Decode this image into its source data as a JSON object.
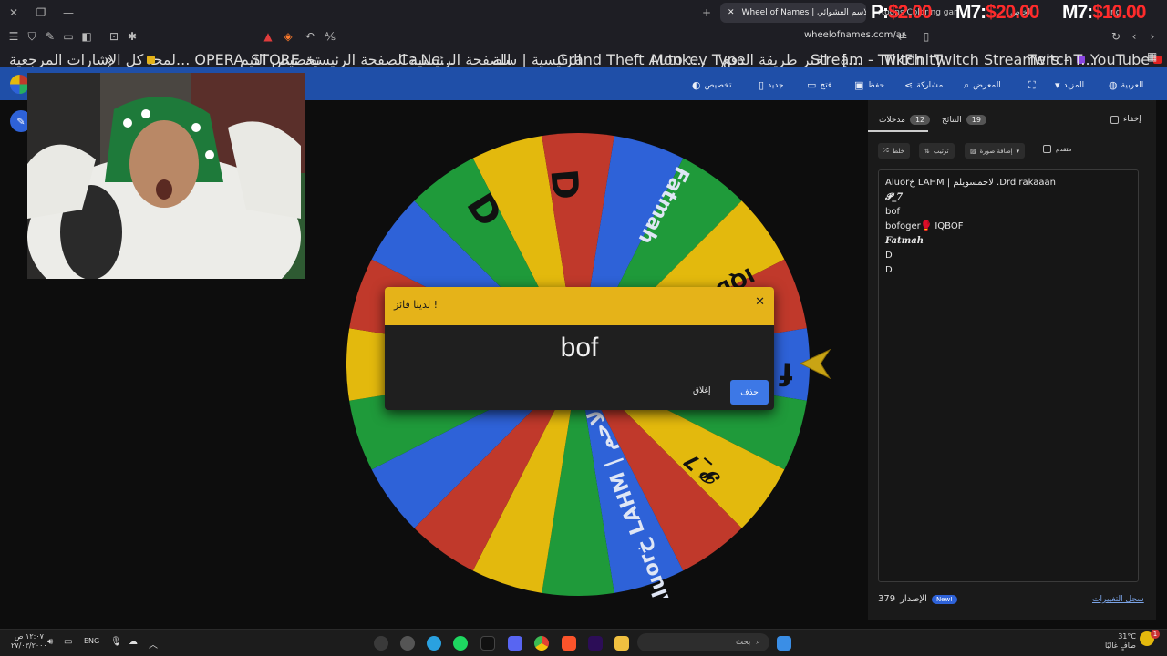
{
  "browser": {
    "active_tab": "Wheel of Names | الاسم العشوائي",
    "tab_partial_1": "rtoons Coloring games",
    "tab_partial_2": "الخاص",
    "tab_partial_3": "ng",
    "url": "wheelofnames.com/ar",
    "bookmarks": [
      "YouTube",
      "Twitch",
      "Twitch Streamers - T...",
      "TikFinity",
      "Stream - Twitch",
      "Monkey Type",
      "اختر طريقة الدفع - [...",
      "Grand Theft Auto :...",
      "الرئيسية | سلة",
      "الصفحة الرئيسية",
      "Ca...",
      "الصفحة الرئيسية - Ne...",
      "تخصيص الثيم",
      "لمحة... OPERA_STORE",
      "كل الإشارات المرجعية"
    ]
  },
  "overlay": {
    "p_label": "P:",
    "p_value": "$2.00",
    "m7a_label": "M7:",
    "m7a_value": "$20.00",
    "m7b_label": "M7:",
    "m7b_value": "$10.00"
  },
  "nav": {
    "language": "العربية",
    "more": "المزيد",
    "gallery": "المعرض",
    "share": "مشاركة",
    "save": "حفظ",
    "open": "فتح",
    "new": "جديد",
    "customize": "تخصيص"
  },
  "panel": {
    "hide_label": "إخفاء",
    "entries_tab": "مدخلات",
    "entries_count": "12",
    "results_tab": "النتائج",
    "results_count": "19",
    "shuffle": "خلط",
    "sort": "ترتيب",
    "add_image": "إضافة صورة",
    "advanced": "متقدم",
    "entries": [
      "Aluorخ LAHM | لاحمسويلم .Drd rakaaan",
      "𝓟_7",
      "bof",
      "bofoger🥊 IQBOF",
      "Fatmah",
      "D",
      "D"
    ],
    "version_label": "الإصدار",
    "version": "379",
    "new_badge": "New!",
    "changelog": "سجل التغييرات"
  },
  "dialog": {
    "title": "لدينا فائز !",
    "winner": "bof",
    "close": "إغلاق",
    "remove": "حذف"
  },
  "wheel_labels": [
    "D",
    "D",
    "Fatmah",
    "IQBO...",
    "f",
    "𝓟_7",
    "Aluorخ LAHM | لاحم..."
  ],
  "colors": {
    "red": "#c0392b",
    "blue": "#2e62d8",
    "green": "#1f9a3a",
    "yellow": "#e3b90d",
    "nav": "#1f4fa8"
  },
  "taskbar": {
    "search": "بحث",
    "language": "ENG",
    "time": "١٢:٠٧ ص",
    "date": "٢٧/٠٣/٢٠٠٠",
    "temp": "31°C",
    "weather": "صافٍ غالبًا",
    "notif": "1"
  }
}
